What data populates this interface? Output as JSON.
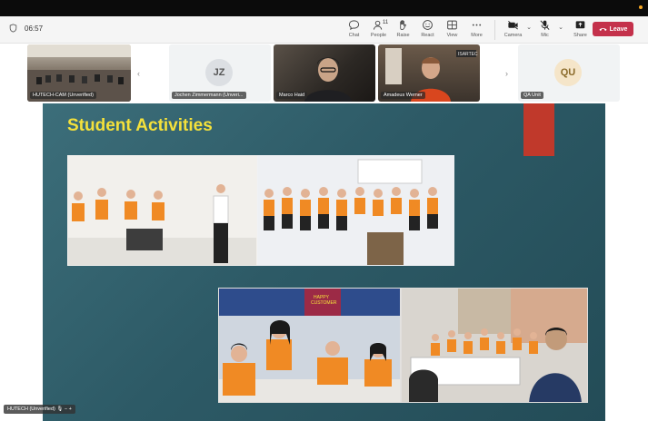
{
  "meeting": {
    "elapsed": "06:57"
  },
  "toolbar": {
    "chat": "Chat",
    "people": "People",
    "people_count": "11",
    "raise": "Raise",
    "react": "React",
    "view": "View",
    "more": "More",
    "camera": "Camera",
    "mic": "Mic",
    "share": "Share",
    "leave": "Leave"
  },
  "participants": [
    {
      "name": "HUTECH-CAM (Unverified)"
    },
    {
      "name": "Jochen Zimmermann (Unveri...",
      "initials": "JZ"
    },
    {
      "name": "Marco Haid"
    },
    {
      "name": "Amadeus Werner"
    },
    {
      "name": "QA Unit",
      "initials": "QU"
    }
  ],
  "slide": {
    "title": "Student Activities",
    "photo_text": {
      "happy_customer": "HAPPY\nCUSTOMER",
      "isartec": "ISARTEC"
    }
  },
  "presenter": {
    "name": "HUTECH (Unverified)"
  },
  "colors": {
    "leave": "#c4314b",
    "slide_title": "#f4e13b",
    "slide_bg": "#2d5a66",
    "accent_rect": "#c0392b"
  }
}
